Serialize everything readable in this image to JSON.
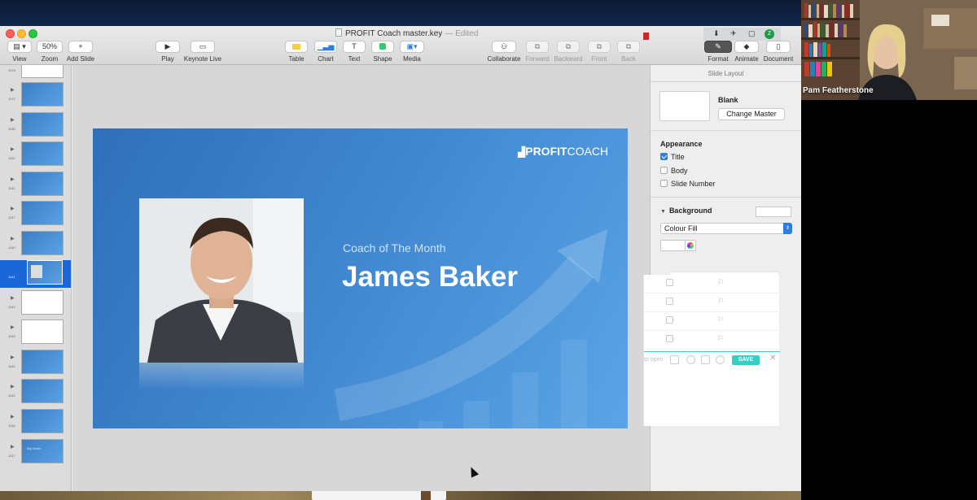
{
  "window": {
    "title": "PROFIT Coach master.key",
    "edited": "— Edited"
  },
  "toolbar": {
    "view": "View",
    "zoom_value": "50%",
    "zoom": "Zoom",
    "add_slide": "Add Slide",
    "play": "Play",
    "keynote_live": "Keynote Live",
    "table": "Table",
    "chart": "Chart",
    "text": "Text",
    "shape": "Shape",
    "media": "Media",
    "collaborate": "Collaborate",
    "forward": "Forward",
    "backward": "Backward",
    "front": "Front",
    "back": "Back",
    "format": "Format",
    "animate": "Animate",
    "document": "Document"
  },
  "navigator": {
    "slides": [
      {
        "num": "1076",
        "style": "white"
      },
      {
        "num": "1077",
        "style": "blue"
      },
      {
        "num": "1080",
        "style": "blue"
      },
      {
        "num": "1102",
        "style": "blue"
      },
      {
        "num": "1011",
        "style": "blue"
      },
      {
        "num": "1157",
        "style": "blue"
      },
      {
        "num": "1140",
        "style": "blue"
      },
      {
        "num": "1141",
        "style": "selected"
      },
      {
        "num": "1142",
        "style": "white"
      },
      {
        "num": "1063",
        "style": "white"
      },
      {
        "num": "1144",
        "style": "blue"
      },
      {
        "num": "1145",
        "style": "blue"
      },
      {
        "num": "1146",
        "style": "blue"
      },
      {
        "num": "1147",
        "style": "blue",
        "text": "Big Notes"
      }
    ]
  },
  "slide": {
    "logo_part1": "PROFIT",
    "logo_part2": "COACH",
    "subtitle": "Coach of The Month",
    "title": "James Baker"
  },
  "inspector": {
    "header": "Slide Layout",
    "master_name": "Blank",
    "change_master": "Change Master",
    "appearance": "Appearance",
    "title_label": "Title",
    "body_label": "Body",
    "slide_number_label": "Slide Number",
    "background": "Background",
    "fill_type": "Colour Fill"
  },
  "overlay": {
    "open_label": "to open",
    "save": "SAVE"
  },
  "video": {
    "presenter": "Pam Featherstone"
  },
  "colors": {
    "slide_blue": "#3f86cf",
    "selection_blue": "#1c67d8",
    "save_teal": "#37cfc5"
  }
}
